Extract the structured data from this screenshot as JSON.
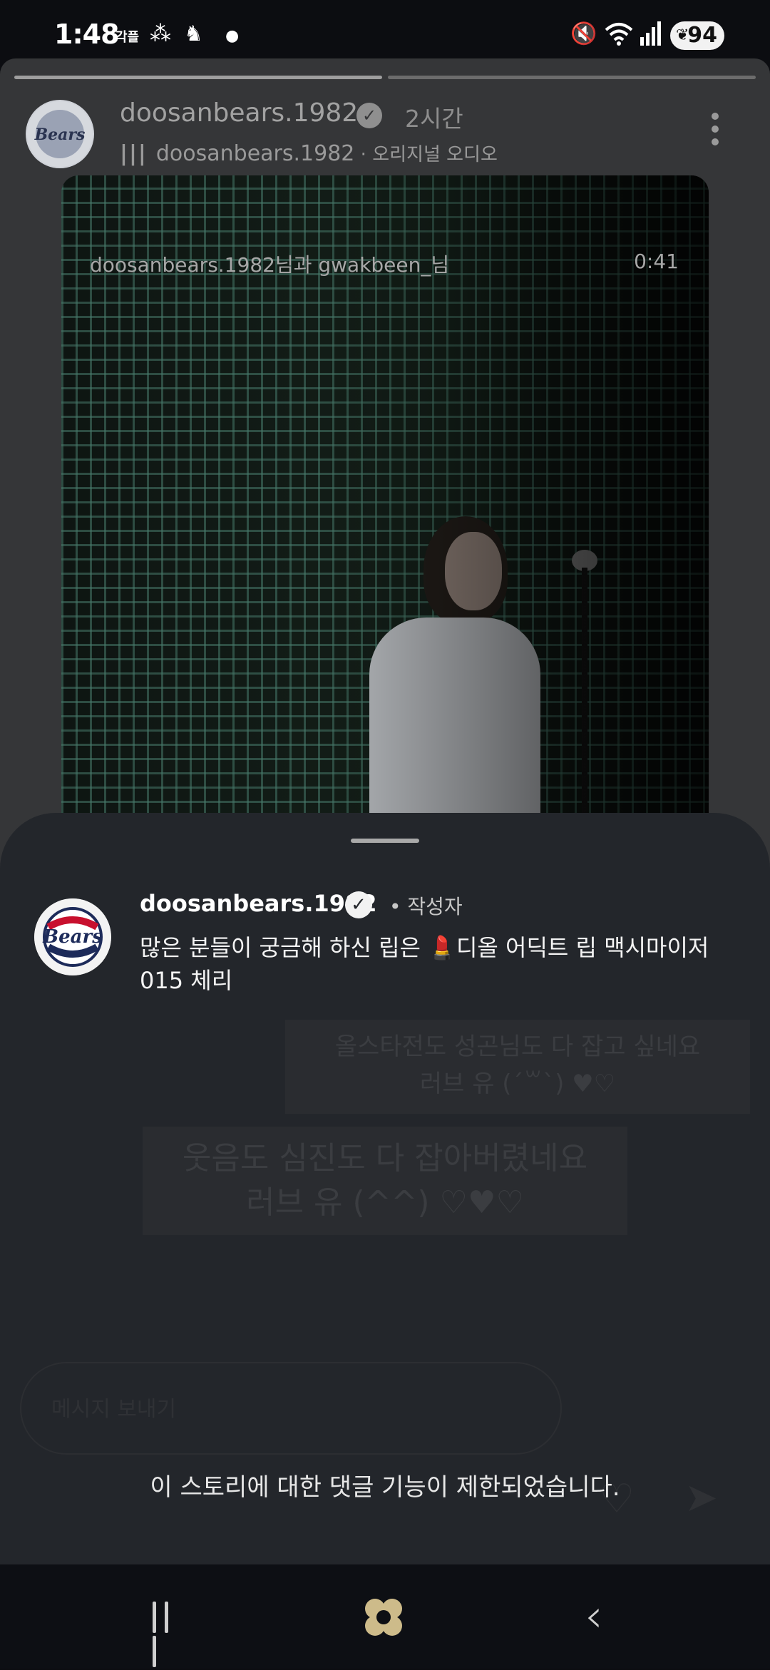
{
  "status_bar": {
    "time": "1:48",
    "carrier_label": "각플",
    "battery": "94"
  },
  "story": {
    "username": "doosanbears.1982",
    "time_ago": "2시간",
    "audio_user": "doosanbears.1982",
    "audio_label": "오리지널 오디오",
    "video_overlay_text": "doosanbears.1982님과 gwakbeen_님",
    "video_duration": "0:41",
    "sticker_top": "올스타전도 성곤님도 다 잡고 싶네요",
    "sticker_top_2": "러브 유 (´꒳`) ♥♡",
    "sticker_bottom": "웃음도 심진도 다 잡아버렸네요",
    "sticker_bottom_2": "러브 유 (^^) ♡♥♡"
  },
  "sheet": {
    "username": "doosanbears.1982",
    "author_label": "• 작성자",
    "caption": "많은 분들이 궁금해 하신 립은 💄디올 어딕트 립 맥시마이저 015 체리"
  },
  "footer": {
    "comment_placeholder": "메시지 보내기",
    "comments_disabled": "이 스토리에 대한 댓글 기능이 제한되었습니다."
  },
  "icons": {
    "verified": "verified-badge-icon",
    "more": "more-options-icon",
    "audio": "audio-bars-icon",
    "mute": "mute-icon",
    "wifi": "wifi-icon",
    "signal": "signal-icon",
    "recent_apps": "recent-apps-icon",
    "home": "home-icon",
    "back": "back-icon"
  }
}
